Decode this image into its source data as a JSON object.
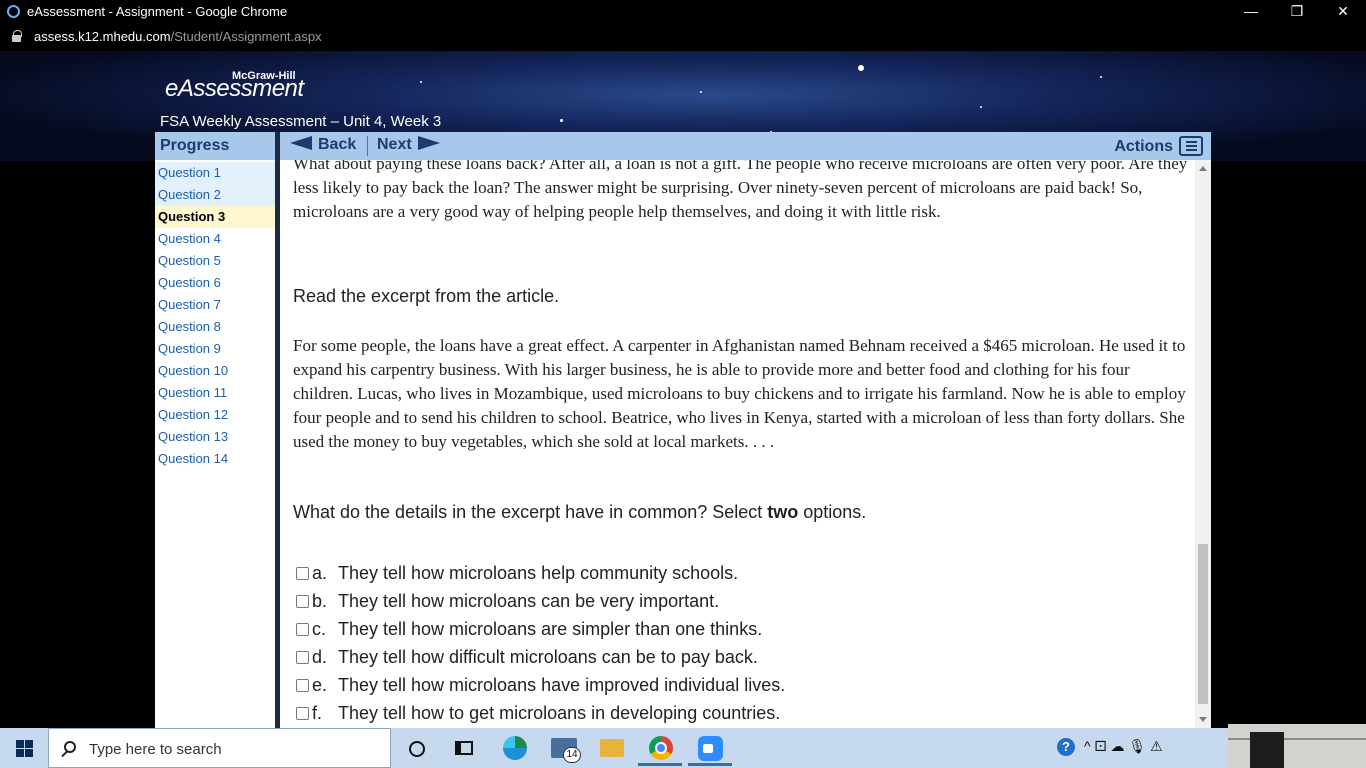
{
  "window": {
    "title": "eAssessment - Assignment - Google Chrome",
    "minimize": "—",
    "restore": "❐",
    "close": "✕"
  },
  "address_bar": {
    "host": "assess.k12.mhedu.com",
    "path": "/Student/Assignment.aspx"
  },
  "header": {
    "publisher": "McGraw-Hill",
    "product": "eAssessment",
    "assessment_title": "FSA Weekly Assessment – Unit 4, Week 3"
  },
  "sidebar": {
    "title": "Progress",
    "questions": [
      {
        "label": "Question 1",
        "state": "answered"
      },
      {
        "label": "Question 2",
        "state": "answered"
      },
      {
        "label": "Question 3",
        "state": "current"
      },
      {
        "label": "Question 4",
        "state": "unanswered"
      },
      {
        "label": "Question 5",
        "state": "unanswered"
      },
      {
        "label": "Question 6",
        "state": "unanswered"
      },
      {
        "label": "Question 7",
        "state": "unanswered"
      },
      {
        "label": "Question 8",
        "state": "unanswered"
      },
      {
        "label": "Question 9",
        "state": "unanswered"
      },
      {
        "label": "Question 10",
        "state": "unanswered"
      },
      {
        "label": "Question 11",
        "state": "unanswered"
      },
      {
        "label": "Question 12",
        "state": "unanswered"
      },
      {
        "label": "Question 13",
        "state": "unanswered"
      },
      {
        "label": "Question 14",
        "state": "unanswered"
      }
    ]
  },
  "toolbar": {
    "back_label": "Back",
    "next_label": "Next",
    "actions_label": "Actions"
  },
  "content": {
    "passage_tail": "What about paying these loans back? After all, a loan is not a gift. The people who receive microloans are often very poor. Are they less likely to pay back the loan? The answer might be surprising. Over ninety-seven percent of microloans are paid back! So, microloans are a very good way of helping people help themselves, and doing it with little risk.",
    "prompt": "Read the excerpt from the article.",
    "excerpt": "For some people, the loans have a great effect. A carpenter in Afghanistan named Behnam received a $465 microloan. He used it to expand his carpentry business. With his larger business, he is able to provide more and better food and clothing for his four children. Lucas, who lives in Mozambique, used microloans to buy chickens and to irrigate his farmland. Now he is able to employ four people and to send his children to school. Beatrice, who lives in Kenya, started with a microloan of less than forty dollars. She used the money to buy vegetables, which she sold at local markets. . . .",
    "question_before": "What do the details in the excerpt have in common? Select ",
    "question_bold": "two",
    "question_after": " options.",
    "options": [
      {
        "letter": "a.",
        "text": "They tell how microloans help community schools."
      },
      {
        "letter": "b.",
        "text": "They tell how microloans can be very important."
      },
      {
        "letter": "c.",
        "text": "They tell how microloans are simpler than one thinks."
      },
      {
        "letter": "d.",
        "text": "They tell how difficult microloans can be to pay back."
      },
      {
        "letter": "e.",
        "text": "They tell how microloans have improved individual lives."
      },
      {
        "letter": "f.",
        "text": "They tell how to get microloans in developing countries."
      }
    ]
  },
  "taskbar": {
    "search_placeholder": "Type here to search",
    "mail_badge": "14",
    "help_glyph": "?",
    "tray_glyphs": "^  ⚀  ☁  🎙  ⚠"
  },
  "colors": {
    "toolbar_bg": "#a7c8ea",
    "link": "#1a5fb4",
    "current_question_bg": "#fff7cf",
    "answered_question_bg": "#e2f0fb"
  }
}
